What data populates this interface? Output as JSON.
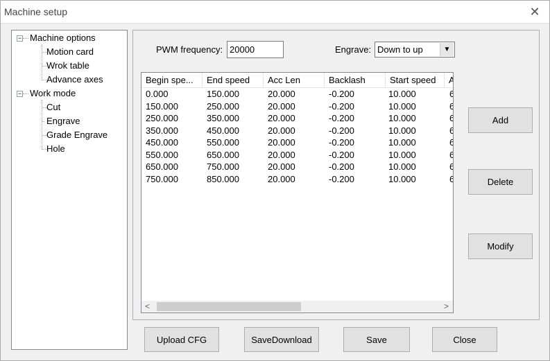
{
  "window": {
    "title": "Machine setup",
    "close_glyph": "✕"
  },
  "tree": {
    "expander_glyph": "−",
    "nodes": [
      {
        "label": "Machine options"
      },
      {
        "label": "Motion card"
      },
      {
        "label": "Wrok table"
      },
      {
        "label": "Advance axes"
      },
      {
        "label": "Work mode"
      },
      {
        "label": "Cut"
      },
      {
        "label": "Engrave"
      },
      {
        "label": "Grade Engrave"
      },
      {
        "label": "Hole"
      }
    ]
  },
  "settings": {
    "pwm_label": "PWM frequency:",
    "pwm_value": "20000",
    "engrave_label": "Engrave:",
    "engrave_value": "Down to up",
    "dropdown_glyph": "▼"
  },
  "table": {
    "columns": [
      "Begin spe...",
      "End speed",
      "Acc Len",
      "Backlash",
      "Start speed",
      "A"
    ],
    "rows": [
      [
        "0.000",
        "150.000",
        "20.000",
        "-0.200",
        "10.000",
        "6"
      ],
      [
        "150.000",
        "250.000",
        "20.000",
        "-0.200",
        "10.000",
        "6"
      ],
      [
        "250.000",
        "350.000",
        "20.000",
        "-0.200",
        "10.000",
        "6"
      ],
      [
        "350.000",
        "450.000",
        "20.000",
        "-0.200",
        "10.000",
        "6"
      ],
      [
        "450.000",
        "550.000",
        "20.000",
        "-0.200",
        "10.000",
        "6"
      ],
      [
        "550.000",
        "650.000",
        "20.000",
        "-0.200",
        "10.000",
        "6"
      ],
      [
        "650.000",
        "750.000",
        "20.000",
        "-0.200",
        "10.000",
        "6"
      ],
      [
        "750.000",
        "850.000",
        "20.000",
        "-0.200",
        "10.000",
        "6"
      ]
    ],
    "scroll_left_glyph": "<",
    "scroll_right_glyph": ">"
  },
  "side_buttons": {
    "add": "Add",
    "delete": "Delete",
    "modify": "Modify"
  },
  "bottom_buttons": {
    "upload": "Upload CFG",
    "save_download": "SaveDownload",
    "save": "Save",
    "close": "Close"
  }
}
